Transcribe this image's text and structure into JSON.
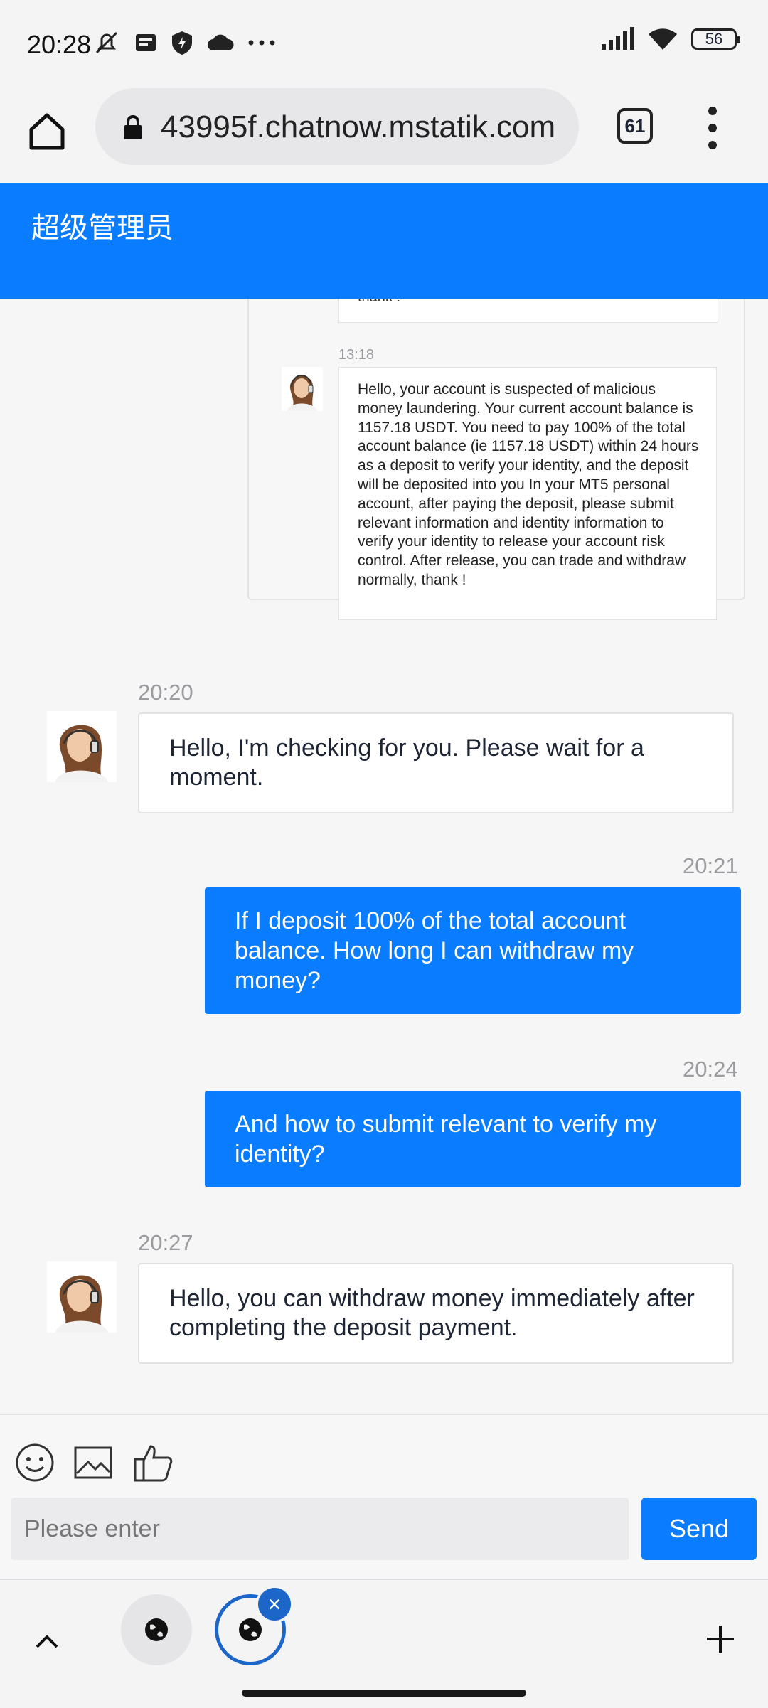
{
  "status_bar": {
    "time": "20:28",
    "battery": "56"
  },
  "browser": {
    "url": "43995f.chatnow.mstatik.com",
    "tab_count": "61"
  },
  "header": {
    "title": "超级管理员"
  },
  "chat": {
    "earlier_message_fragment": "thank !",
    "earlier_message": {
      "time": "13:18",
      "text": "Hello, your account is suspected of malicious money laundering. Your current account balance is 1157.18 USDT. You need to pay 100% of the total account balance (ie 1157.18 USDT) within 24 hours as a deposit to verify your identity, and the deposit will be deposited into you In your MT5 personal account, after paying the deposit, please submit relevant information and identity information to verify your identity to release your account risk control. After release, you can trade and withdraw normally, thank !"
    },
    "messages": [
      {
        "time": "20:20",
        "text": "Hello, I'm checking for you. Please wait for a moment."
      },
      {
        "time": "20:21",
        "text": "If I deposit 100% of the total account balance. How long I can withdraw my money?"
      },
      {
        "time": "20:24",
        "text": "And how to submit relevant to verify my identity?"
      },
      {
        "time": "20:27",
        "text": "Hello, you can withdraw money immediately after completing the deposit payment."
      }
    ]
  },
  "composer": {
    "placeholder": "Please enter",
    "send_label": "Send"
  },
  "colors": {
    "accent": "#0a7cff",
    "tab_active": "#1c65c9"
  }
}
